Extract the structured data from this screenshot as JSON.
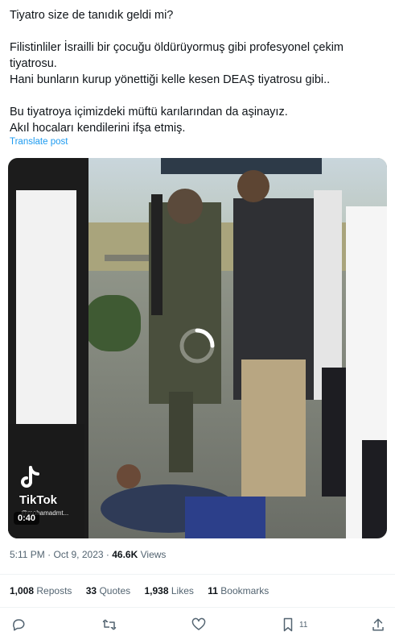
{
  "post": {
    "lines": [
      "Tiyatro size de tanıdık geldi mi?",
      "Filistinliler İsrailli bir çocuğu öldürüyormuş gibi profesyonel çekim",
      "tiyatrosu.",
      "Hani bunların kurup yönettiği kelle kesen DEAŞ tiyatrosu gibi..",
      "Bu tiyatroya içimizdeki müftü karılarından da aşinayız.",
      "Akıl hocaları kendilerini ifşa etmiş."
    ],
    "translate_label": "Translate post"
  },
  "video": {
    "tiktok_name": "TikTok",
    "tiktok_handle": "@mohamadmt...",
    "duration": "0:40"
  },
  "meta": {
    "time": "5:11 PM",
    "separator": "·",
    "date": "Oct 9, 2023",
    "views_count": "46.6K",
    "views_label": "Views"
  },
  "stats": {
    "reposts_count": "1,008",
    "reposts_label": "Reposts",
    "quotes_count": "33",
    "quotes_label": "Quotes",
    "likes_count": "1,938",
    "likes_label": "Likes",
    "bookmarks_count": "11",
    "bookmarks_label": "Bookmarks"
  },
  "actions": {
    "bookmark_count": "11"
  },
  "colors": {
    "text": "#0f1419",
    "secondary": "#536471",
    "link": "#1d9bf0",
    "divider": "#eff3f4"
  },
  "icons": [
    "reply-icon",
    "repost-icon",
    "like-icon",
    "bookmark-icon",
    "share-icon",
    "tiktok-icon",
    "loading-spinner-icon"
  ]
}
